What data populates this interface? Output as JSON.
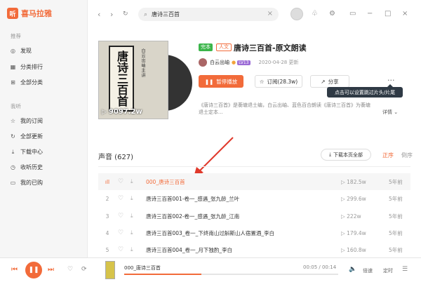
{
  "app": {
    "logo_glyph": "听",
    "name": "喜马拉雅"
  },
  "sidebar": {
    "recommend_title": "推荐",
    "recommend": [
      {
        "icon": "compass-icon",
        "label": "发现"
      },
      {
        "icon": "ranking-icon",
        "label": "分类排行"
      },
      {
        "icon": "grid-icon",
        "label": "全部分类"
      }
    ],
    "mine_title": "我听",
    "mine": [
      {
        "icon": "subscribe-icon",
        "label": "我的订阅"
      },
      {
        "icon": "refresh-icon",
        "label": "全部更新"
      },
      {
        "icon": "download-icon",
        "label": "下载中心"
      },
      {
        "icon": "history-icon",
        "label": "收听历史"
      },
      {
        "icon": "cart-icon",
        "label": "我的已购"
      }
    ]
  },
  "search": {
    "value": "唐诗三百首"
  },
  "book": {
    "cover_title": "唐诗三百首",
    "cover_sub": "白云出岫主讲",
    "cover_plays": "9097.2w",
    "tag_complete": "完本",
    "tag_category": "人文",
    "title": "唐诗三百首-原文朗读",
    "author": "白云出岫",
    "level": "LV13",
    "date": "2020-04-28 更新",
    "play_btn": "暂停播放",
    "sub_btn": "订阅(28.3w)",
    "share_btn": "分享",
    "tooltip": "点击可以设置跳过片头/片尾",
    "desc": "《唐诗三百首》是蘅塘退士编，白云出岫、蓝色百合朗读《唐诗三百首》为蘅塘退士定本...",
    "detail": "详情"
  },
  "tracks": {
    "header": "声音 (627)",
    "download_btn": "下载本页全部",
    "sort_asc": "正序",
    "sort_desc": "倒序",
    "rows": [
      {
        "num": "",
        "name": "000_唐诗三百首",
        "plays": "182.5w",
        "age": "5年前"
      },
      {
        "num": "2",
        "name": "唐诗三百首001-卷一_感遇_张九龄_兰叶",
        "plays": "299.6w",
        "age": "5年前"
      },
      {
        "num": "3",
        "name": "唐诗三百首002-卷一_感遇_张九龄_江南",
        "plays": "222w",
        "age": "5年前"
      },
      {
        "num": "4",
        "name": "唐诗三百首003_卷一_下终南山过斛斯山人宿置酒_李白",
        "plays": "179.4w",
        "age": "5年前"
      },
      {
        "num": "5",
        "name": "唐诗三百首004_卷一_月下独酌_李白",
        "plays": "160.8w",
        "age": "5年前"
      }
    ]
  },
  "player": {
    "title": "000_唐诗三百首",
    "time": "00:05 / 00:14",
    "progress": 0.36,
    "speed": "倍速",
    "timer": "定时"
  },
  "colors": {
    "accent": "#f26b3a",
    "tag_green": "#3bb54a"
  }
}
